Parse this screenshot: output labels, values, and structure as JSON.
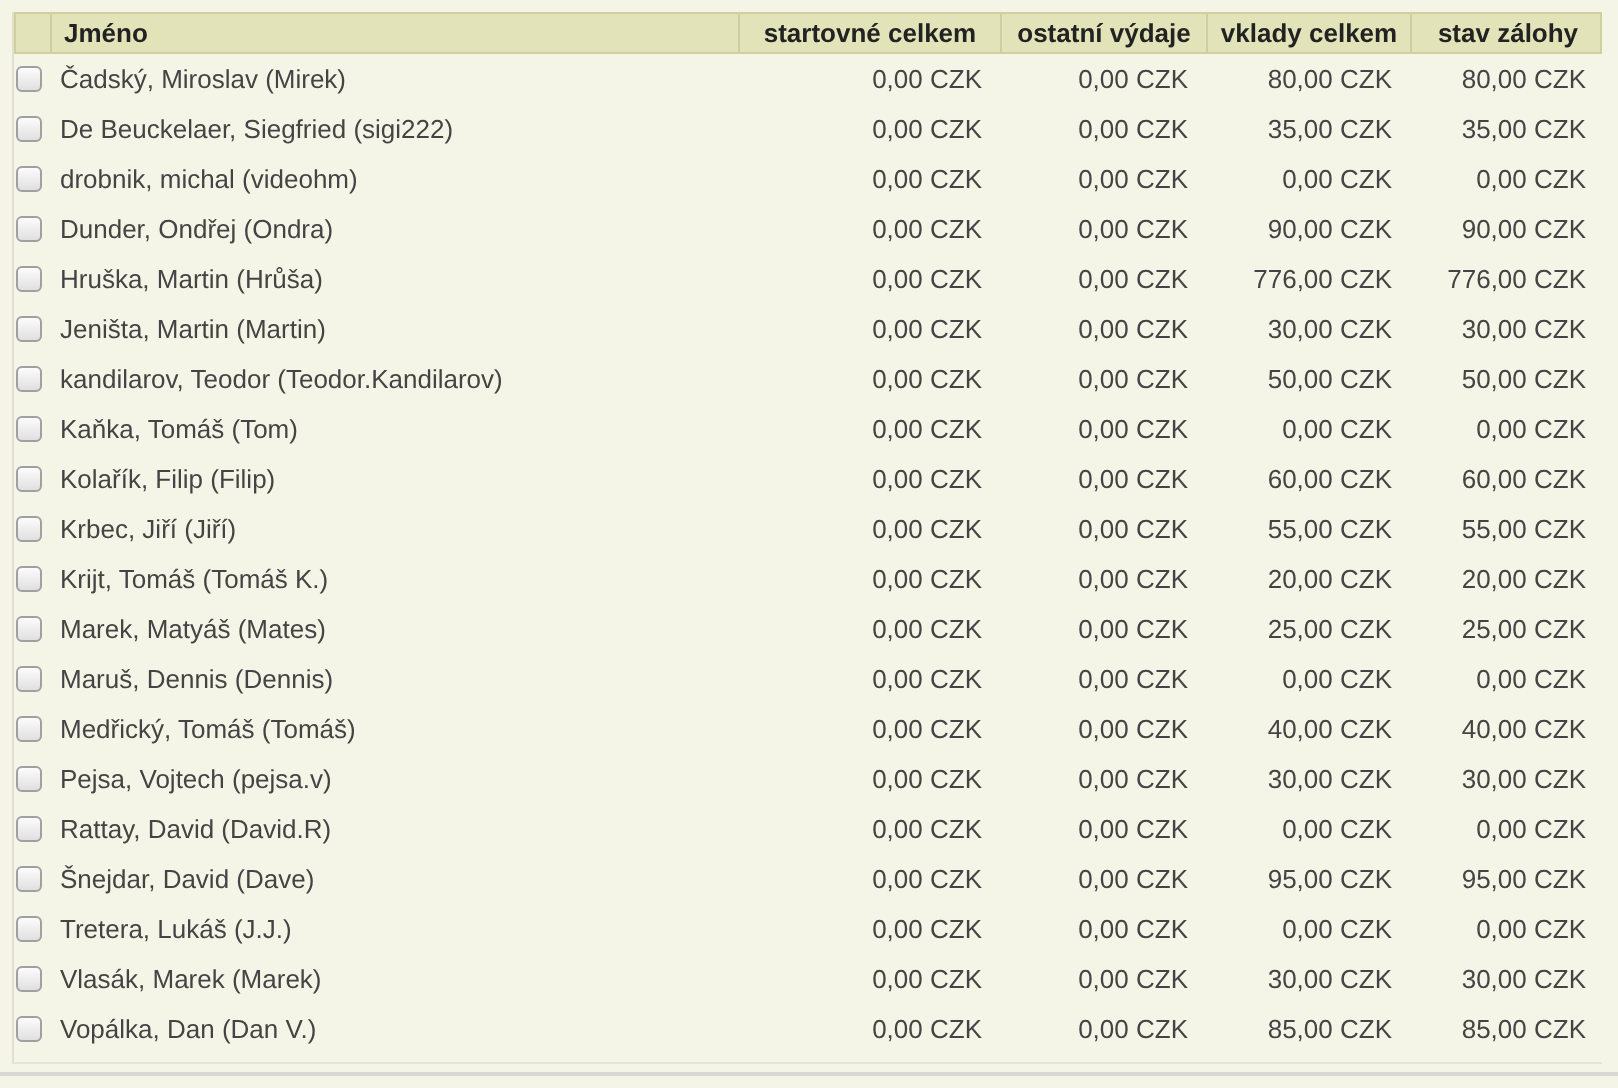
{
  "table": {
    "columns": [
      "Jméno",
      "startovné celkem",
      "ostatní výdaje",
      "vklady celkem",
      "stav zálohy"
    ],
    "rows": [
      {
        "checked": false,
        "name": "Čadský, Miroslav (Mirek)",
        "values": [
          "0,00 CZK",
          "0,00 CZK",
          "80,00 CZK",
          "80,00 CZK"
        ]
      },
      {
        "checked": false,
        "name": "De Beuckelaer, Siegfried (sigi222)",
        "values": [
          "0,00 CZK",
          "0,00 CZK",
          "35,00 CZK",
          "35,00 CZK"
        ]
      },
      {
        "checked": false,
        "name": "drobnik, michal (videohm)",
        "values": [
          "0,00 CZK",
          "0,00 CZK",
          "0,00 CZK",
          "0,00 CZK"
        ]
      },
      {
        "checked": false,
        "name": "Dunder, Ondřej (Ondra)",
        "values": [
          "0,00 CZK",
          "0,00 CZK",
          "90,00 CZK",
          "90,00 CZK"
        ]
      },
      {
        "checked": false,
        "name": "Hruška, Martin (Hrůša)",
        "values": [
          "0,00 CZK",
          "0,00 CZK",
          "776,00 CZK",
          "776,00 CZK"
        ]
      },
      {
        "checked": false,
        "name": "Jeništa, Martin (Martin)",
        "values": [
          "0,00 CZK",
          "0,00 CZK",
          "30,00 CZK",
          "30,00 CZK"
        ]
      },
      {
        "checked": false,
        "name": "kandilarov, Teodor (Teodor.Kandilarov)",
        "values": [
          "0,00 CZK",
          "0,00 CZK",
          "50,00 CZK",
          "50,00 CZK"
        ]
      },
      {
        "checked": false,
        "name": "Kaňka, Tomáš (Tom)",
        "values": [
          "0,00 CZK",
          "0,00 CZK",
          "0,00 CZK",
          "0,00 CZK"
        ]
      },
      {
        "checked": false,
        "name": "Kolařík, Filip (Filip)",
        "values": [
          "0,00 CZK",
          "0,00 CZK",
          "60,00 CZK",
          "60,00 CZK"
        ]
      },
      {
        "checked": false,
        "name": "Krbec, Jiří (Jiří)",
        "values": [
          "0,00 CZK",
          "0,00 CZK",
          "55,00 CZK",
          "55,00 CZK"
        ]
      },
      {
        "checked": false,
        "name": "Krijt, Tomáš (Tomáš K.)",
        "values": [
          "0,00 CZK",
          "0,00 CZK",
          "20,00 CZK",
          "20,00 CZK"
        ]
      },
      {
        "checked": false,
        "name": "Marek, Matyáš (Mates)",
        "values": [
          "0,00 CZK",
          "0,00 CZK",
          "25,00 CZK",
          "25,00 CZK"
        ]
      },
      {
        "checked": false,
        "name": "Maruš, Dennis (Dennis)",
        "values": [
          "0,00 CZK",
          "0,00 CZK",
          "0,00 CZK",
          "0,00 CZK"
        ]
      },
      {
        "checked": false,
        "name": "Medřický, Tomáš (Tomáš)",
        "values": [
          "0,00 CZK",
          "0,00 CZK",
          "40,00 CZK",
          "40,00 CZK"
        ]
      },
      {
        "checked": false,
        "name": "Pejsa, Vojtech (pejsa.v)",
        "values": [
          "0,00 CZK",
          "0,00 CZK",
          "30,00 CZK",
          "30,00 CZK"
        ]
      },
      {
        "checked": false,
        "name": "Rattay, David (David.R)",
        "values": [
          "0,00 CZK",
          "0,00 CZK",
          "0,00 CZK",
          "0,00 CZK"
        ]
      },
      {
        "checked": false,
        "name": "Šnejdar, David (Dave)",
        "values": [
          "0,00 CZK",
          "0,00 CZK",
          "95,00 CZK",
          "95,00 CZK"
        ]
      },
      {
        "checked": false,
        "name": "Tretera, Lukáš (J.J.)",
        "values": [
          "0,00 CZK",
          "0,00 CZK",
          "0,00 CZK",
          "0,00 CZK"
        ]
      },
      {
        "checked": false,
        "name": "Vlasák, Marek (Marek)",
        "values": [
          "0,00 CZK",
          "0,00 CZK",
          "30,00 CZK",
          "30,00 CZK"
        ]
      },
      {
        "checked": false,
        "name": "Vopálka, Dan (Dan V.)",
        "values": [
          "0,00 CZK",
          "0,00 CZK",
          "85,00 CZK",
          "85,00 CZK"
        ]
      }
    ]
  }
}
